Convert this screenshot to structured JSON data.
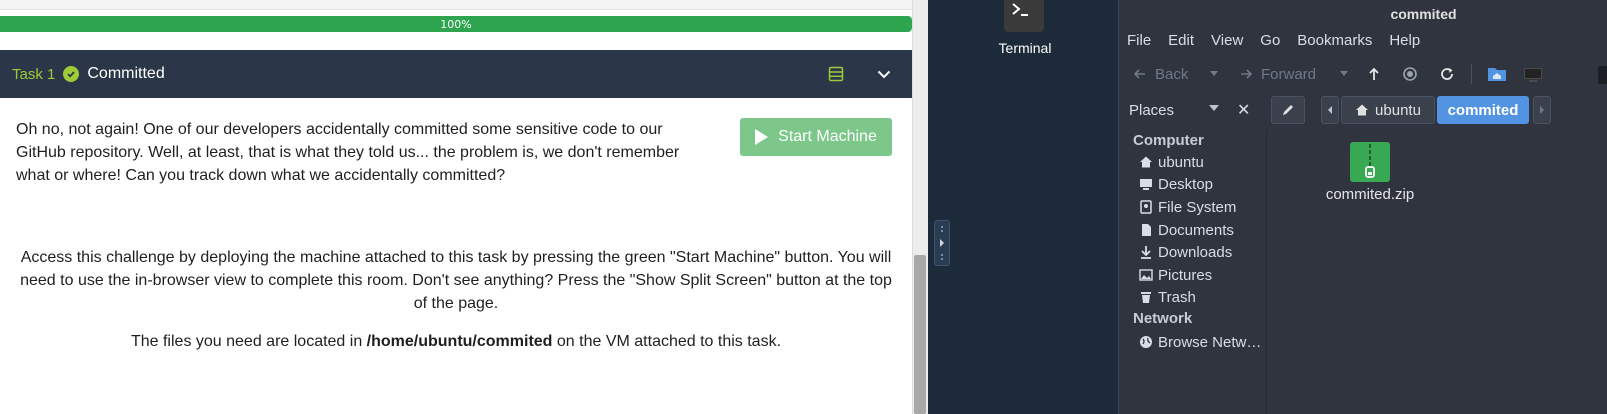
{
  "progress": {
    "label": "100%",
    "value": 100
  },
  "task": {
    "number_label": "Task 1",
    "title": "Committed",
    "intro": "Oh no, not again! One of our developers accidentally committed some sensitive code to our GitHub repository. Well, at least, that is what they told us... the problem is, we don't remember what or where! Can you track down what we accidentally committed?",
    "start_button": "Start Machine",
    "access_text": "Access this challenge by deploying the machine attached to this task by pressing the green \"Start Machine\" button. You will need to use the in-browser view to complete this room. Don't see anything? Press the \"Show Split Screen\" button at the top of the page.",
    "files_prefix": "The files you need are located in ",
    "files_path": "/home/ubuntu/commited",
    "files_suffix": " on the VM attached to this task.",
    "accent_color": "#9ccc38",
    "header_color": "#2b3648",
    "button_color": "#7cc789"
  },
  "desktop": {
    "terminal_label": "Terminal"
  },
  "file_manager": {
    "title": "commited",
    "menu": [
      "File",
      "Edit",
      "View",
      "Go",
      "Bookmarks",
      "Help"
    ],
    "toolbar": {
      "back": "Back",
      "forward": "Forward"
    },
    "places_label": "Places",
    "path": [
      "ubuntu",
      "commited"
    ],
    "sidebar": {
      "computer_header": "Computer",
      "computer_items": [
        {
          "label": "ubuntu",
          "icon": "home-icon"
        },
        {
          "label": "Desktop",
          "icon": "desktop-icon"
        },
        {
          "label": "File System",
          "icon": "drive-icon"
        },
        {
          "label": "Documents",
          "icon": "document-icon"
        },
        {
          "label": "Downloads",
          "icon": "download-icon"
        },
        {
          "label": "Pictures",
          "icon": "picture-icon"
        },
        {
          "label": "Trash",
          "icon": "trash-icon"
        }
      ],
      "network_header": "Network",
      "network_items": [
        {
          "label": "Browse Netw…",
          "icon": "globe-icon"
        }
      ]
    },
    "files": [
      {
        "name": "commited.zip",
        "icon": "zip-archive-icon"
      }
    ],
    "selected_color": "#5294e2"
  }
}
